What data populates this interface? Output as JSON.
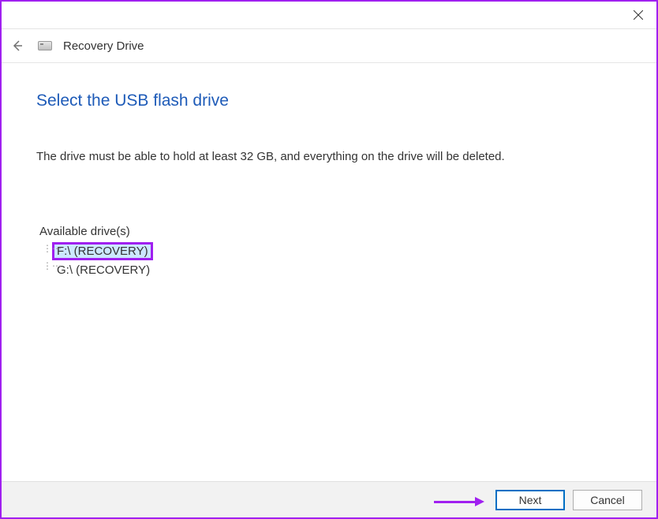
{
  "header": {
    "title": "Recovery Drive"
  },
  "page": {
    "heading": "Select the USB flash drive",
    "description": "The drive must be able to hold at least 32 GB, and everything on the drive will be deleted."
  },
  "drives": {
    "label": "Available drive(s)",
    "items": [
      {
        "label": "F:\\ (RECOVERY)",
        "selected": true
      },
      {
        "label": "G:\\ (RECOVERY)",
        "selected": false
      }
    ]
  },
  "buttons": {
    "next": "Next",
    "cancel": "Cancel"
  }
}
